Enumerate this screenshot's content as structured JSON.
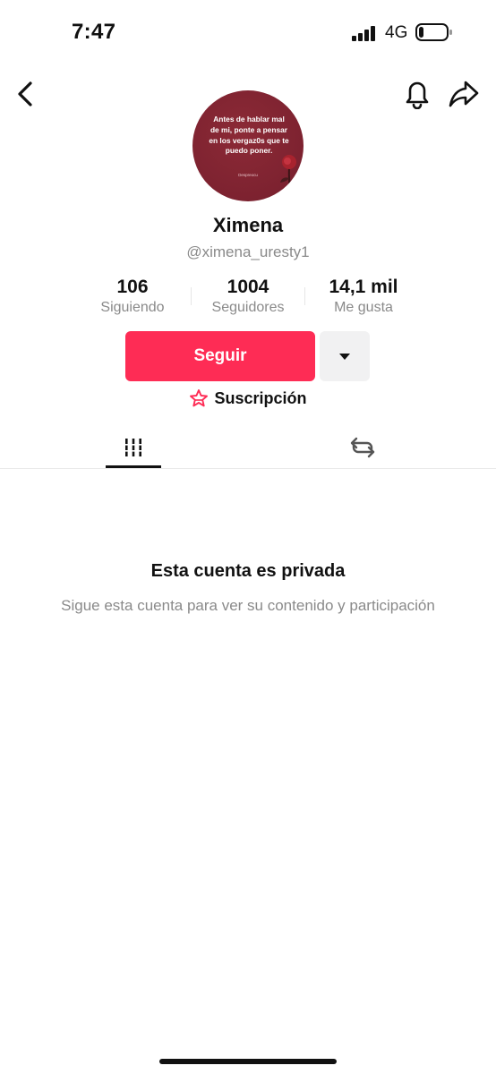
{
  "status_bar": {
    "time": "7:47",
    "network": "4G"
  },
  "profile": {
    "avatar_quote": "Antes de hablar mal de mi, ponte a pensar en los vergaz0s que te puedo poner.",
    "avatar_signature": "Despreocu",
    "name": "Ximena",
    "handle": "@ximena_uresty1"
  },
  "stats": [
    {
      "value": "106",
      "label": "Siguiendo"
    },
    {
      "value": "1004",
      "label": "Seguidores"
    },
    {
      "value": "14,1 mil",
      "label": "Me gusta"
    }
  ],
  "actions": {
    "follow_label": "Seguir",
    "subscription_label": "Suscripción"
  },
  "tabs": {
    "active": "videos",
    "items": [
      "videos-grid-icon",
      "repost-icon"
    ]
  },
  "private": {
    "title": "Esta cuenta es privada",
    "subtitle": "Sigue esta cuenta para ver su contenido y participación"
  },
  "colors": {
    "accent": "#fe2c55",
    "avatar_bg": "#7d2230",
    "secondary_text": "#8a8a8a"
  }
}
